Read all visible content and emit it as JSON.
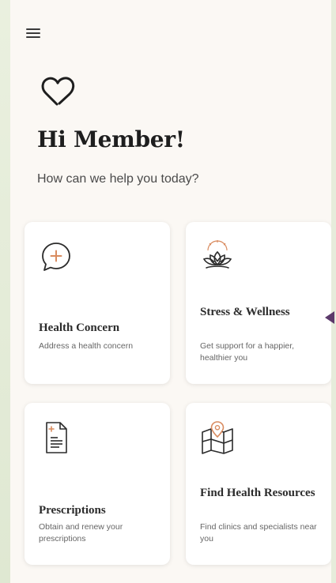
{
  "header": {
    "menu_icon": "hamburger-menu-icon",
    "logo_icon": "heart-outline-logo"
  },
  "greeting": {
    "title": "Hi Member!",
    "subtitle": "How can we help you today?"
  },
  "cards": [
    {
      "icon": "chat-plus-icon",
      "title": "Health Concern",
      "description": "Address a health concern"
    },
    {
      "icon": "lotus-icon",
      "title": "Stress & Wellness",
      "description": "Get support for a happier, healthier you"
    },
    {
      "icon": "prescription-document-icon",
      "title": "Prescriptions",
      "description": "Obtain and renew your prescriptions"
    },
    {
      "icon": "map-pin-icon",
      "title": "Find Health Resources",
      "description": "Find clinics and specialists near you"
    }
  ],
  "colors": {
    "background": "#fbf8f4",
    "card": "#ffffff",
    "accent_orange": "#d98b5f",
    "text_dark": "#1e1e1e",
    "pointer": "#5c3a6b",
    "side_green": "#e3ead8"
  }
}
